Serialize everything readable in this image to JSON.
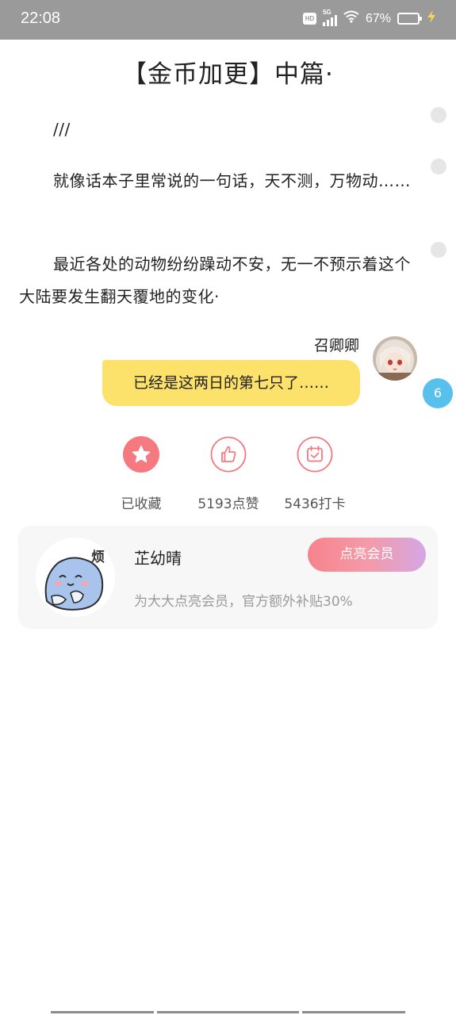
{
  "status_bar": {
    "time": "22:08",
    "network": "5G",
    "battery": "67%",
    "battery_level": 0.67,
    "hd_badge": "HD"
  },
  "chapter": {
    "title": "【金币加更】中篇·",
    "paragraphs": [
      "///",
      "就像话本子里常说的一句话，天不测，万物动……",
      "最近各处的动物纷纷躁动不安，无一不预示着这个大陆要发生翻天覆地的变化·"
    ]
  },
  "dialogue": {
    "speaker": "召卿卿",
    "message": "已经是这两日的第七只了……",
    "comment_count": "6"
  },
  "actions": [
    {
      "label": "已收藏",
      "icon": "star-icon"
    },
    {
      "label": "5193点赞",
      "icon": "thumbs-up-icon"
    },
    {
      "label": "5436打卡",
      "icon": "calendar-check-icon"
    }
  ],
  "member_card": {
    "name": "芷幼晴",
    "description": "为大大点亮会员，官方额外补贴30%",
    "button_label": "点亮会员",
    "sticker_text": "烦"
  },
  "colors": {
    "accent": "#f47a80",
    "bubble": "#fce16a",
    "badge": "#58c0ec",
    "status_bar": "#9a9a9a"
  }
}
